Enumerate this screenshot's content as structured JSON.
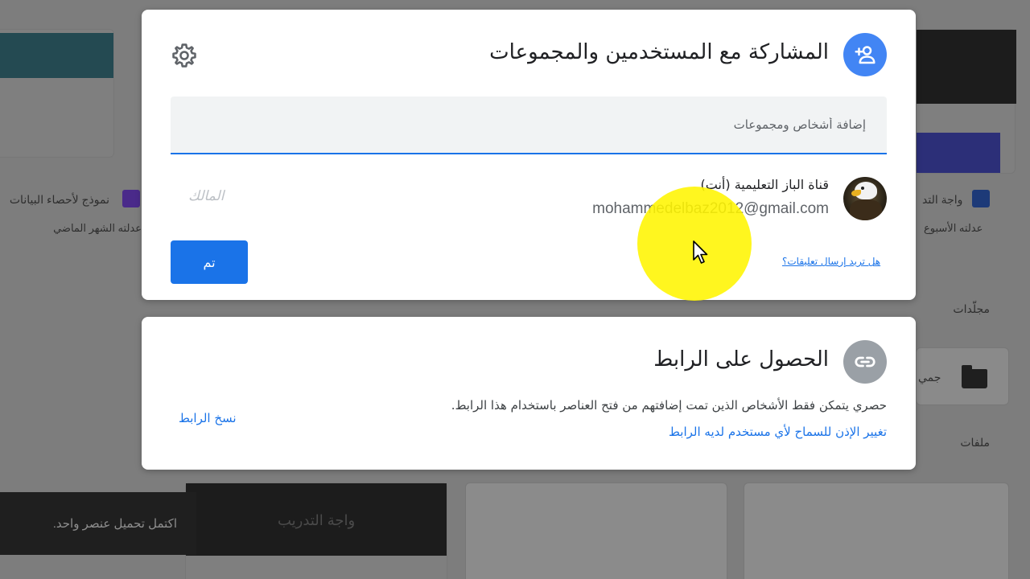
{
  "background": {
    "left_card_title": "نموذج لأحصاء البيانات",
    "left_card_subtitle": "عدلته الشهر الماضي",
    "right_card_title": "واجة التد",
    "right_card_subtitle": "عدلته الأسبوع",
    "folders_heading": "مجلّدات",
    "files_heading": "ملفات",
    "folder_name_partial": "جمي",
    "file_thumb_title": "واجة التدريب",
    "toast_text": "اكتمل تحميل عنصر واحد."
  },
  "share_dialog": {
    "title": "المشاركة مع المستخدمين والمجموعات",
    "add_placeholder": "إضافة أشخاص ومجموعات",
    "user": {
      "name": "قناة الباز التعليمية (أنت)",
      "email": "mohammedelbaz2012@gmail.com",
      "role": "المالك"
    },
    "done_label": "تم",
    "feedback_label": "هل تريد إرسال تعليقات؟",
    "icons": {
      "header": "person-add-icon",
      "settings": "gear-icon"
    }
  },
  "link_dialog": {
    "title": "الحصول على الرابط",
    "description": "حصري يتمكن فقط الأشخاص الذين تمت إضافتهم من فتح العناصر باستخدام هذا الرابط.",
    "change_permission": "تغيير الإذن للسماح لأي مستخدم لديه الرابط",
    "copy_link": "نسخ الرابط",
    "icons": {
      "header": "link-icon"
    }
  },
  "colors": {
    "accent": "#1a73e8",
    "badge_blue": "#4285f4",
    "badge_grey": "#9aa0a6",
    "cursor_highlight": "#fff500"
  }
}
